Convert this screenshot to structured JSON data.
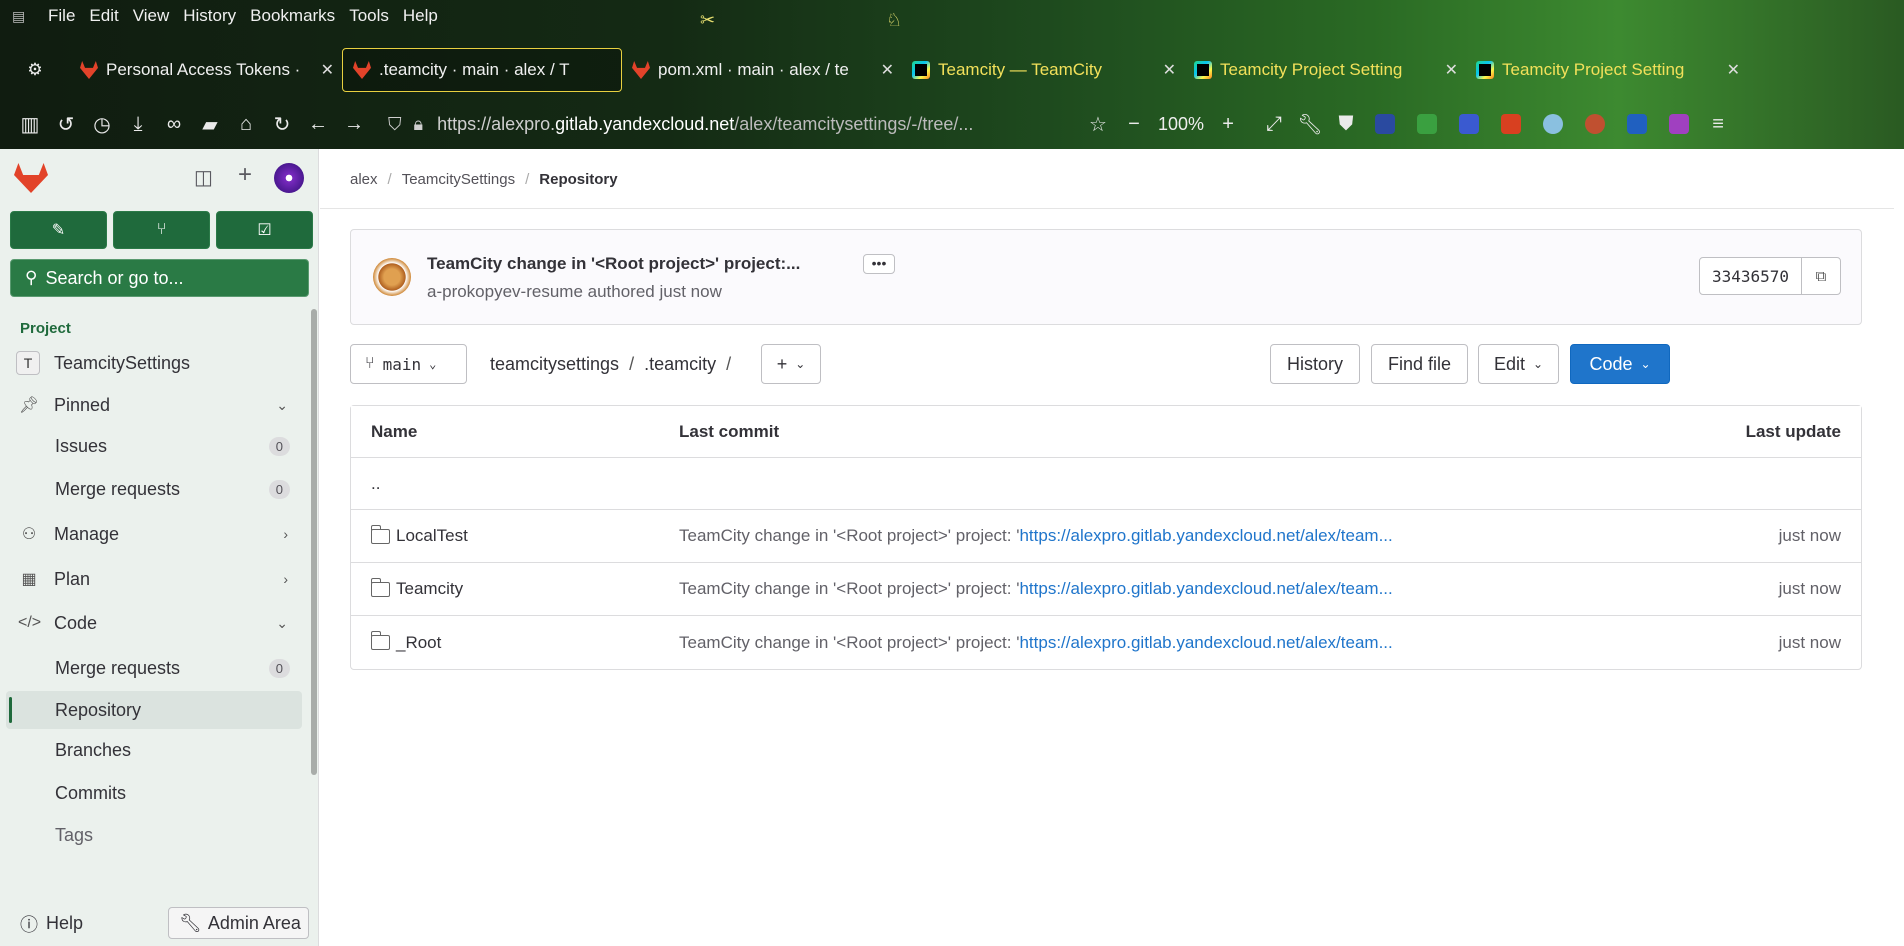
{
  "browser": {
    "menu": [
      "File",
      "Edit",
      "View",
      "History",
      "Bookmarks",
      "Tools",
      "Help"
    ],
    "tabs": [
      {
        "title": "Personal Access Tokens · ",
        "icon": "gitlab"
      },
      {
        "title": ".teamcity · main · alex / T",
        "icon": "gitlab",
        "active": true
      },
      {
        "title": "pom.xml · main · alex / te",
        "icon": "gitlab"
      },
      {
        "title": "Teamcity — TeamCity",
        "icon": "teamcity"
      },
      {
        "title": "Teamcity Project Setting",
        "icon": "teamcity"
      },
      {
        "title": "Teamcity Project Setting",
        "icon": "teamcity"
      }
    ],
    "url_domain_prefix": "https://alexpro.",
    "url_domain": "gitlab.yandexcloud.net",
    "url_path": "/alex/teamcitysettings/-/tree/...",
    "zoom": "100%"
  },
  "sidebar": {
    "search_label": "Search or go to...",
    "section": "Project",
    "project_letter": "T",
    "project_name": "TeamcitySettings",
    "pinned": "Pinned",
    "issues": "Issues",
    "issues_count": "0",
    "merge_requests": "Merge requests",
    "merge_requests_count": "0",
    "manage": "Manage",
    "plan": "Plan",
    "code": "Code",
    "code_mr": "Merge requests",
    "code_mr_count": "0",
    "repository": "Repository",
    "branches": "Branches",
    "commits": "Commits",
    "tags": "Tags",
    "help": "Help",
    "admin": "Admin Area"
  },
  "breadcrumb": [
    "alex",
    "TeamcitySettings",
    "Repository"
  ],
  "commit": {
    "title": "TeamCity change in '<Root project>' project:...",
    "author": "a-prokopyev-resume",
    "authored": "authored just now",
    "sha": "33436570"
  },
  "toolbar": {
    "branch": "main",
    "path": [
      "teamcitysettings",
      ".teamcity"
    ],
    "history": "History",
    "find_file": "Find file",
    "edit": "Edit",
    "code": "Code"
  },
  "table": {
    "headers": [
      "Name",
      "Last commit",
      "Last update"
    ],
    "parent": "..",
    "rows": [
      {
        "name": "LocalTest",
        "commit_text": "TeamCity change in '<Root project>' project: '",
        "commit_link": "https://alexpro.gitlab.yandexcloud.net/alex/team...",
        "updated": "just now"
      },
      {
        "name": "Teamcity",
        "commit_text": "TeamCity change in '<Root project>' project: '",
        "commit_link": "https://alexpro.gitlab.yandexcloud.net/alex/team...",
        "updated": "just now"
      },
      {
        "name": "_Root",
        "commit_text": "TeamCity change in '<Root project>' project: '",
        "commit_link": "https://alexpro.gitlab.yandexcloud.net/alex/team...",
        "updated": "just now"
      }
    ]
  }
}
